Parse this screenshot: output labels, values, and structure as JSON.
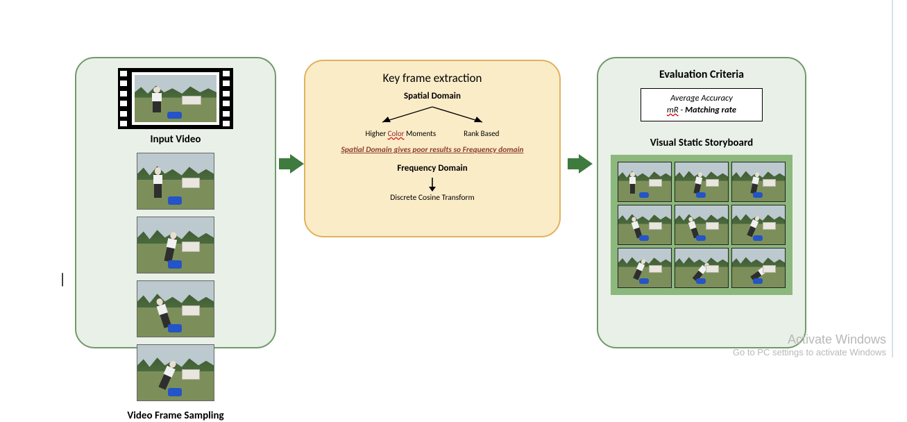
{
  "left": {
    "input_video_label": "Input Video",
    "sampling_label": "Video Frame Sampling"
  },
  "mid": {
    "title": "Key frame extraction",
    "spatial_heading": "Spatial Domain",
    "branch_left_pre": "Higher ",
    "branch_left_color": "Color",
    "branch_left_post": " Moments",
    "branch_right": "Rank Based",
    "note": "Spatial Domain gives poor results so Frequency domain",
    "frequency_heading": "Frequency Domain",
    "dct": "Discrete Cosine Transform"
  },
  "right": {
    "eval_title": "Evaluation Criteria",
    "avg_accuracy": "Average Accuracy",
    "mr_m": "mR",
    "mr_dash": " - ",
    "mr_rate": "Matching  rate",
    "story_title": "Visual Static Storyboard"
  },
  "watermark": {
    "l1": "Activate Windows",
    "l2": "Go to PC settings to activate Windows"
  }
}
